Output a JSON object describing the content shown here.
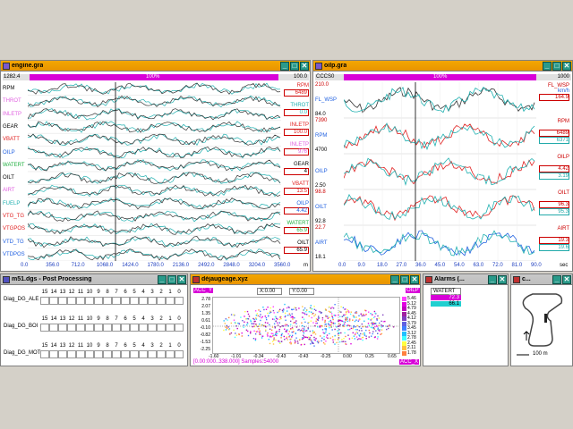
{
  "engine": {
    "title": "engine.gra",
    "top_left": "1282.4",
    "top_pct": "100%",
    "top_right": "100.0",
    "rows": [
      {
        "label": "RPM",
        "color": "#000000"
      },
      {
        "label": "THROT",
        "color": "#e060e0"
      },
      {
        "label": "INLETP",
        "color": "#e060e0"
      },
      {
        "label": "GEAR",
        "color": "#000000"
      },
      {
        "label": "VBATT",
        "color": "#e02020"
      },
      {
        "label": "OILP",
        "color": "#2060e0"
      },
      {
        "label": "WATERT",
        "color": "#20b040"
      },
      {
        "label": "OILT",
        "color": "#000000"
      },
      {
        "label": "AIRT",
        "color": "#e060e0"
      },
      {
        "label": "FUELP",
        "color": "#20b0b0"
      },
      {
        "label": "VTG_TG",
        "color": "#e02020"
      },
      {
        "label": "VTGPOS",
        "color": "#e02020"
      },
      {
        "label": "VTD_TG",
        "color": "#2060e0"
      },
      {
        "label": "VTDPOS",
        "color": "#2060e0"
      }
    ],
    "right_values": [
      {
        "name": "RPM",
        "value": "6489",
        "color": "#e02020"
      },
      {
        "name": "THROT",
        "value": "0.0",
        "color": "#20b0b0"
      },
      {
        "name": "INLETP",
        "value": "100.0",
        "color": "#e02020"
      },
      {
        "name": "INLETP",
        "value": "976",
        "color": "#e060e0"
      },
      {
        "name": "GEAR",
        "value": "4",
        "color": "#000000"
      },
      {
        "name": "VBATT",
        "value": "13.5",
        "color": "#e02020"
      },
      {
        "name": "OILP",
        "value": "4.42",
        "color": "#2060e0"
      },
      {
        "name": "WATERT",
        "value": "65.9",
        "color": "#20b040"
      },
      {
        "name": "OILT",
        "value": "65.9",
        "color": "#000000"
      }
    ],
    "x_ticks": [
      "0.0",
      "356.0",
      "712.0",
      "1068.0",
      "1424.0",
      "1780.0",
      "2136.0",
      "2492.0",
      "2848.0",
      "3204.0",
      "3560.0"
    ],
    "x_unit": "m"
  },
  "oilp": {
    "title": "oilp.gra",
    "top_left": "CCCS0",
    "top_pct": "100%",
    "top_right": "1000",
    "rows": [
      {
        "label": "FL_WSP",
        "top": "210.0",
        "bot": "84.0"
      },
      {
        "label": "RPM",
        "top": "7390",
        "bot": "4700"
      },
      {
        "label": "OILP",
        "top": "",
        "bot": "2.50"
      },
      {
        "label": "OILT",
        "top": "98.8",
        "bot": "92.8"
      },
      {
        "label": "AIRT",
        "top": "22.7",
        "bot": "18.1"
      }
    ],
    "right": [
      {
        "name": "FL_WSP",
        "unit": "km/h",
        "v1": "164.9",
        "v2": ""
      },
      {
        "name": "RPM",
        "unit": "",
        "v1": "6489",
        "v2": "6371"
      },
      {
        "name": "OILP",
        "unit": "",
        "v1": "4.42",
        "v2": "3.19"
      },
      {
        "name": "OILT",
        "unit": "",
        "v1": "96.3",
        "v2": "95.3"
      },
      {
        "name": "AIRT",
        "unit": "",
        "v1": "19.3",
        "v2": "19.6"
      }
    ],
    "x_ticks": [
      "0.0",
      "9.0",
      "18.0",
      "27.0",
      "36.0",
      "45.0",
      "54.0",
      "63.0",
      "72.0",
      "81.0",
      "90.0"
    ],
    "x_unit": "sec"
  },
  "post": {
    "title": "m51.dgs - Post Processing",
    "header": [
      "15",
      "14",
      "13",
      "12",
      "11",
      "10",
      "9",
      "8",
      "7",
      "6",
      "5",
      "4",
      "3",
      "2",
      "1",
      "0"
    ],
    "rows": [
      "Diag_DG_ALE",
      "Diag_DG_BOI",
      "Diag_DG_MOT"
    ]
  },
  "dej": {
    "title": "déjaugeage.xyz",
    "acc_label": "ACC_Y",
    "x_field": "X:0.00",
    "y_field": "Y:0.00",
    "oilp_tag": "OILP",
    "acc_x_label": "ACC_X",
    "status": "[0.00:000..338.000]  Samples:54000",
    "y_ticks": [
      "2.78",
      "2.07",
      "1.35",
      "0.61",
      "-0.10",
      "-0.82",
      "-1.53",
      "-2.25"
    ],
    "x_ticks": [
      "-1.60",
      "-1.01",
      "-0.34",
      "-0.43",
      "-0.43",
      "-0.25",
      "0.00",
      "0.25",
      "0.65"
    ],
    "legend": [
      "5.46",
      "5.12",
      "4.79",
      "4.45",
      "4.12",
      "3.79",
      "3.45",
      "3.12",
      "2.78",
      "2.45",
      "2.11",
      "1.78"
    ],
    "legend_colors": [
      "#ff40ff",
      "#e000e0",
      "#c000c0",
      "#a020a0",
      "#8040c0",
      "#6060e0",
      "#4080ff",
      "#20c0ff",
      "#40ffff",
      "#ffff40",
      "#ffc040",
      "#ff8040"
    ]
  },
  "alarms": {
    "title": "Alarms (...",
    "name": "WATERT",
    "v1": "72.3",
    "v2": "66.1"
  },
  "track": {
    "title": "c...",
    "scale": "100 m"
  }
}
